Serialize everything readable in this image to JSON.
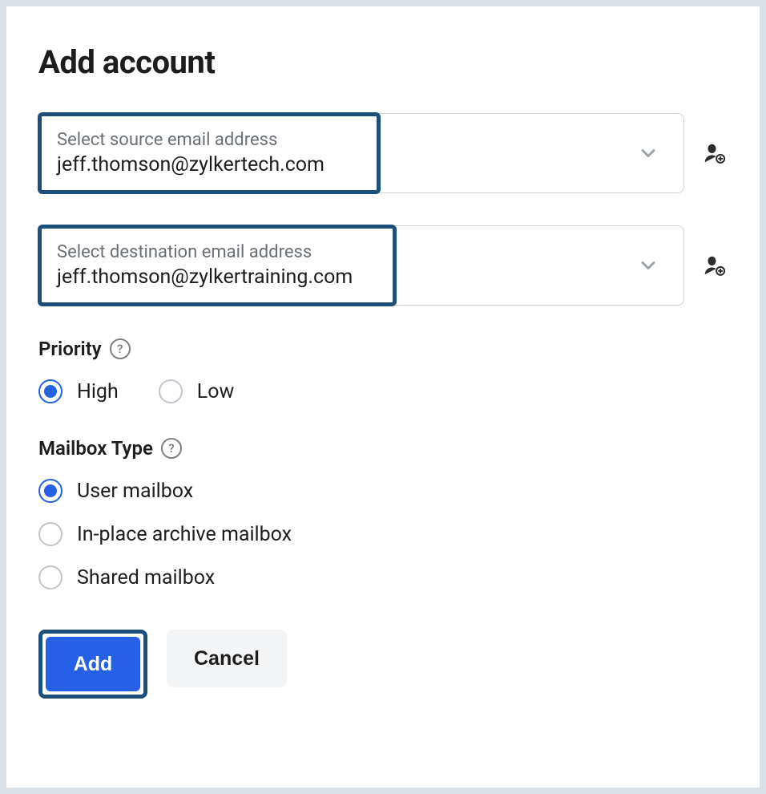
{
  "title": "Add account",
  "source": {
    "label": "Select source email address",
    "value": "jeff.thomson@zylkertech.com"
  },
  "destination": {
    "label": "Select destination email address",
    "value": "jeff.thomson@zylkertraining.com"
  },
  "priority": {
    "label": "Priority",
    "options": {
      "high": "High",
      "low": "Low"
    },
    "selected": "high"
  },
  "mailbox": {
    "label": "Mailbox Type",
    "options": {
      "user": "User mailbox",
      "archive": "In-place archive mailbox",
      "shared": "Shared mailbox"
    },
    "selected": "user"
  },
  "buttons": {
    "add": "Add",
    "cancel": "Cancel"
  },
  "help_glyph": "?"
}
